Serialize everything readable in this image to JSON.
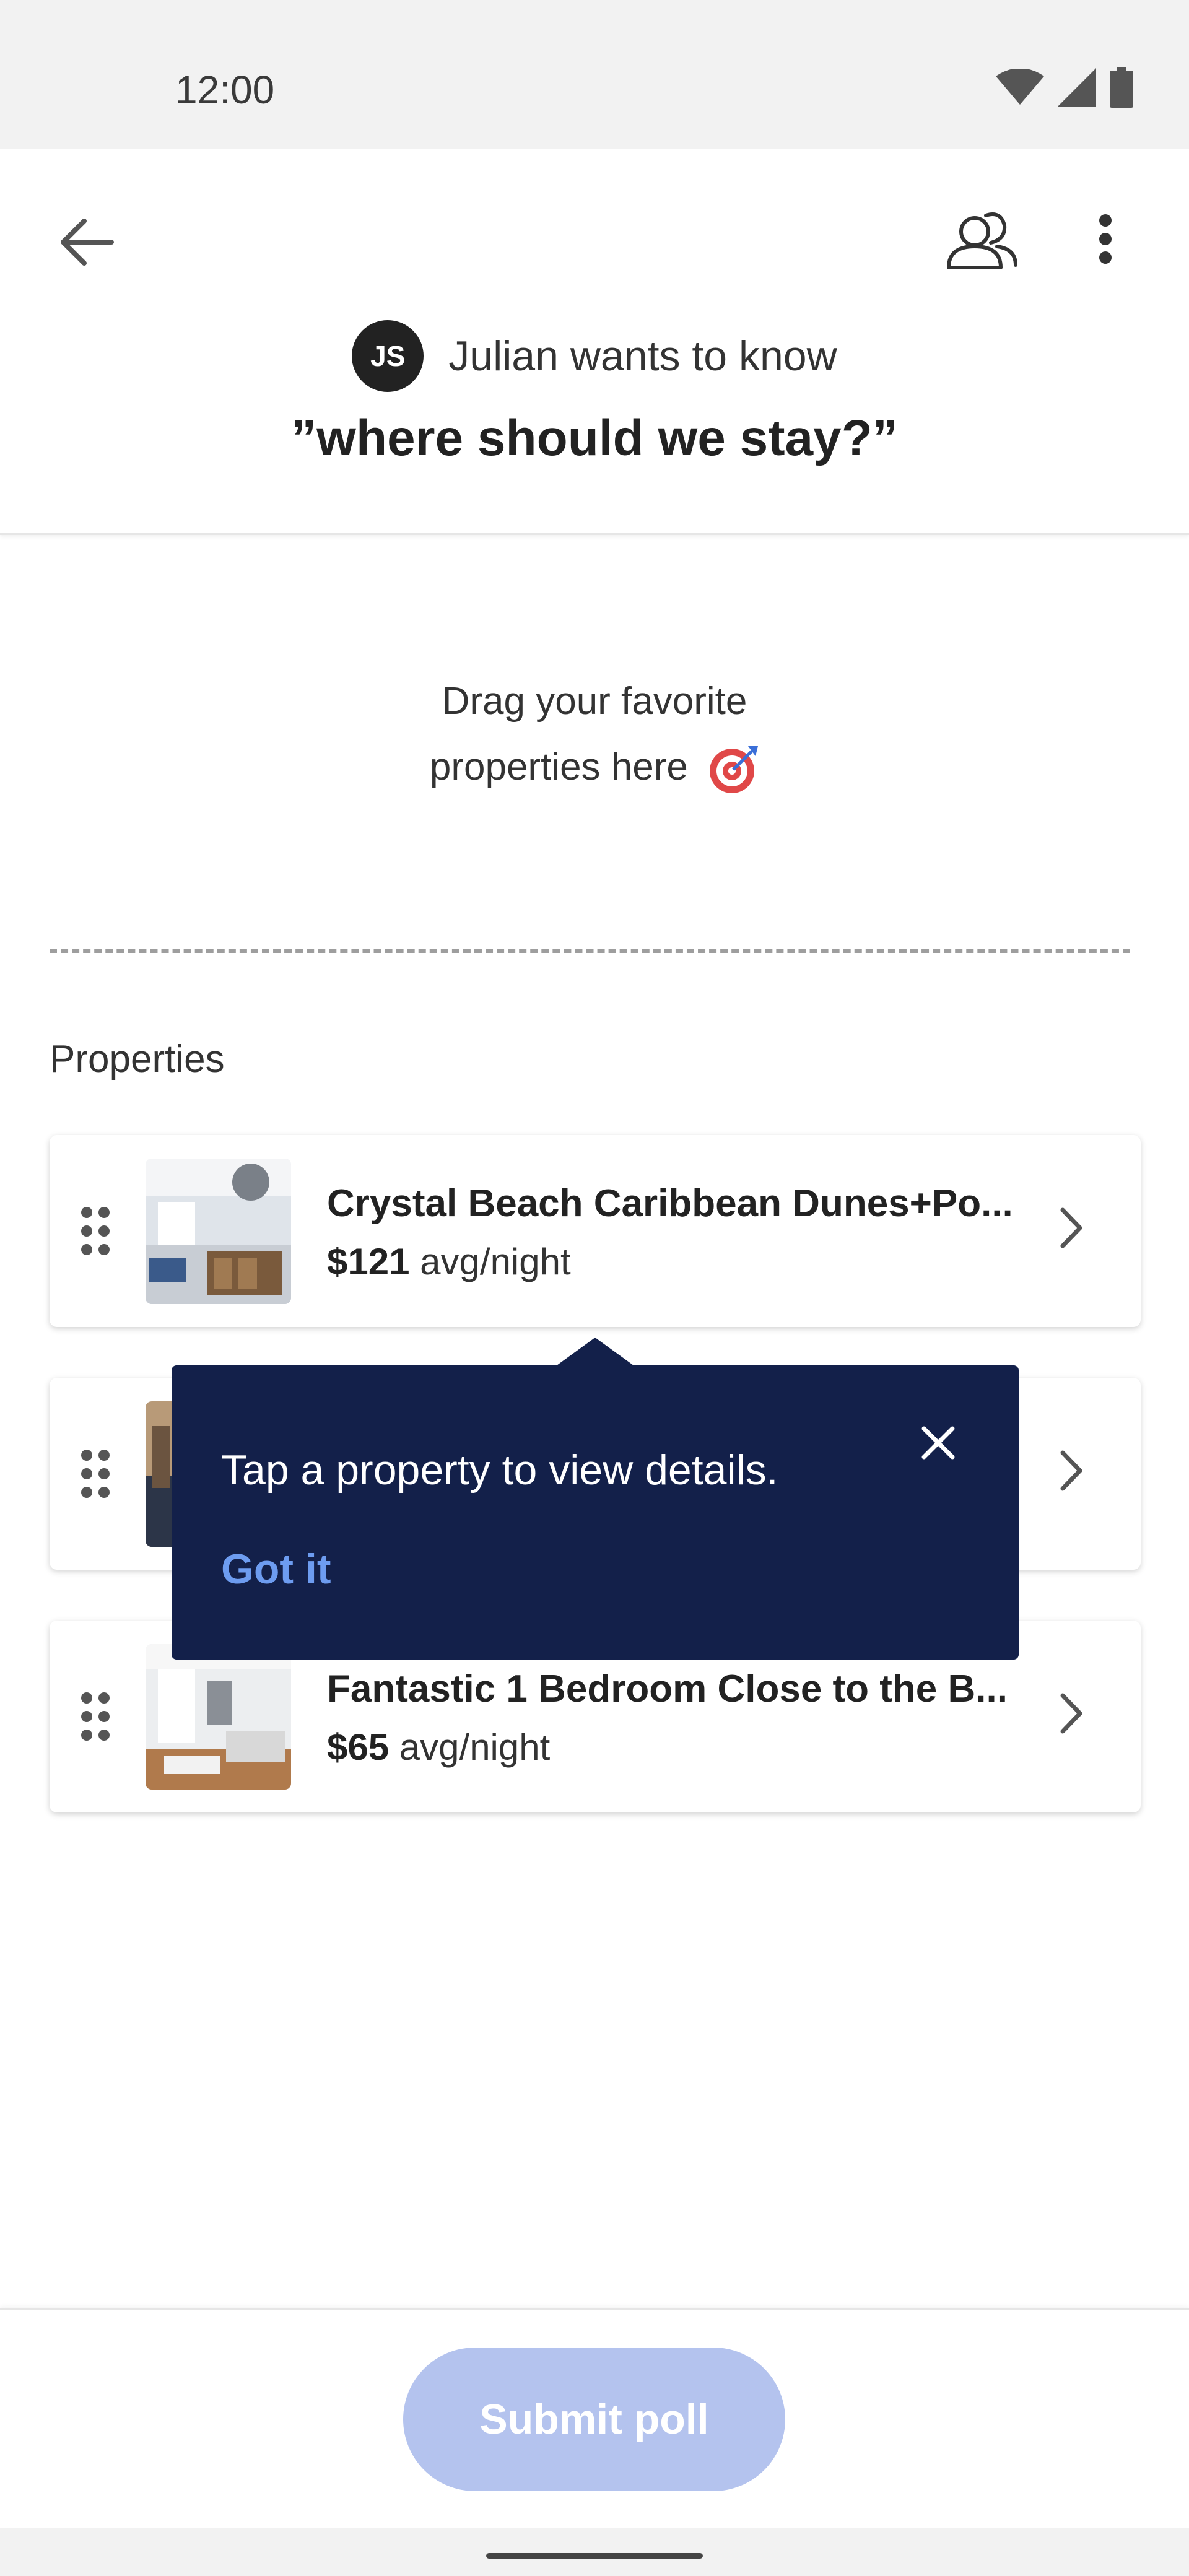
{
  "status_bar": {
    "time": "12:00",
    "icons": [
      "wifi-icon",
      "signal-icon",
      "battery-icon"
    ]
  },
  "header": {
    "back_icon": "arrow-back-icon",
    "people_icon": "people-icon",
    "more_icon": "more-vert-icon",
    "avatar_initials": "JS",
    "asker_text": "Julian wants to know",
    "question": "”where should we stay?”"
  },
  "drop_zone": {
    "line1": "Drag your favorite",
    "line2": "properties here",
    "icon": "target-icon"
  },
  "properties": {
    "section_label": "Properties",
    "items": [
      {
        "title": "Crystal Beach Caribbean Dunes+Po...",
        "price": "$121",
        "unit": "avg/night"
      },
      {
        "title": "",
        "price": "",
        "unit": ""
      },
      {
        "title": "Fantastic 1 Bedroom Close to the B...",
        "price": "$65",
        "unit": "avg/night"
      }
    ]
  },
  "tooltip": {
    "text": "Tap a property to view details.",
    "action": "Got it",
    "close_icon": "close-icon"
  },
  "footer": {
    "submit_label": "Submit poll"
  },
  "colors": {
    "tooltip_bg": "#13204a",
    "link": "#6d9cf0",
    "submit_disabled": "#b4c3ee"
  }
}
